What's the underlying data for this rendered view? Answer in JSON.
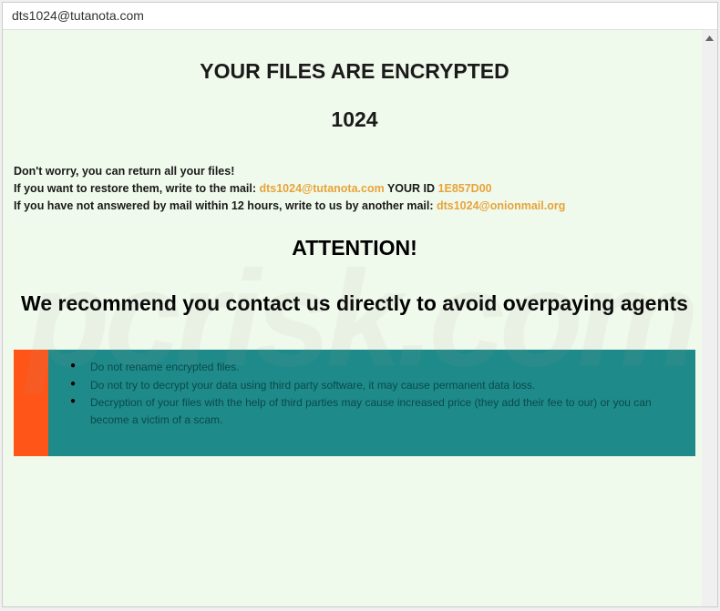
{
  "window": {
    "title": "dts1024@tutanota.com"
  },
  "headline": "YOUR FILES ARE ENCRYPTED",
  "subhead": "1024",
  "intro": {
    "line1": "Don't worry, you can return all your files!",
    "line2_a": "If you want to restore them, write to the mail:  ",
    "email1": "dts1024@tutanota.com",
    "id_label": "   YOUR ID ",
    "id_value": "1E857D00",
    "line3_a": "If you have not answered by mail within 12 hours, write to us by another mail:  ",
    "email2": "dts1024@onionmail.org"
  },
  "attention": "ATTENTION!",
  "recommend": "We recommend you contact us directly to avoid overpaying agents",
  "warnings": [
    "Do not rename encrypted files.",
    "Do not try to decrypt your data using third party software, it may cause permanent data loss.",
    "Decryption of your files with the help of third parties may cause increased price (they add their fee to our) or you can become a victim of a scam."
  ],
  "watermark": "pcrisk.com"
}
